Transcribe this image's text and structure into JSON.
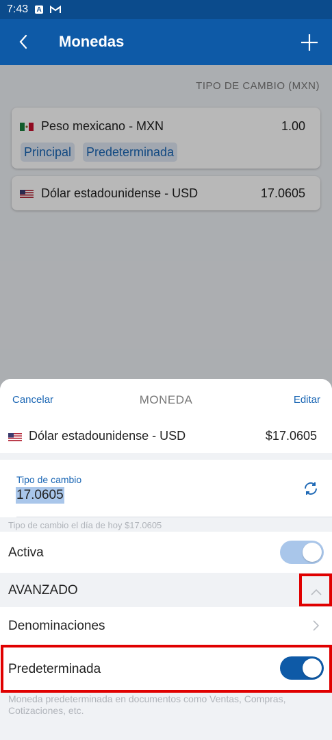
{
  "status_bar": {
    "time": "7:43",
    "icons": [
      "a-square-icon",
      "gmail-icon"
    ]
  },
  "app_bar": {
    "title": "Monedas",
    "icons": [
      "chevron-left-icon",
      "plus-icon"
    ]
  },
  "list": {
    "header": "TIPO DE CAMBIO (MXN)",
    "items": [
      {
        "flag": "mexico-flag-icon",
        "name": "Peso mexicano - MXN",
        "value": "1.00",
        "tags": [
          "Principal",
          "Predeterminada"
        ]
      },
      {
        "flag": "us-flag-icon",
        "name": "Dólar estadounidense - USD",
        "value": "17.0605",
        "tags": []
      }
    ]
  },
  "sheet": {
    "cancel": "Cancelar",
    "title": "MONEDA",
    "edit": "Editar",
    "currency": {
      "flag": "us-flag-icon",
      "name": "Dólar estadounidense - USD",
      "value": "$17.0605"
    },
    "rate": {
      "label": "Tipo de cambio",
      "value": "17.0605",
      "hint": "Tipo de cambio el día de hoy $17.0605",
      "icon": "refresh-icon"
    },
    "activa": {
      "label": "Activa",
      "enabled": true
    },
    "advanced": {
      "label": "AVANZADO",
      "icon": "chevron-up-icon"
    },
    "denominations": {
      "label": "Denominaciones",
      "icon": "chevron-right-icon"
    },
    "default": {
      "label": "Predeterminada",
      "enabled": true,
      "hint": "Moneda predeterminada en documentos como Ventas, Compras, Cotizaciones, etc."
    }
  },
  "colors": {
    "primary": "#0e5aa7",
    "status_bar": "#0b4b8c",
    "link": "#1a66b4",
    "highlight": "#e00000",
    "toggle_disabled": "#a9c6ea"
  }
}
